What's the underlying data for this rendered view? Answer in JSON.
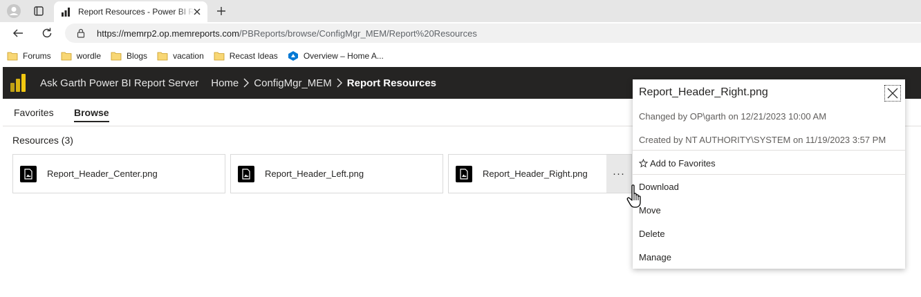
{
  "browser": {
    "tab": {
      "title": "Report Resources - Power BI Report Server"
    },
    "url": {
      "host": "https://memrp2.op.memreports.com",
      "path": "/PBReports/browse/ConfigMgr_MEM/Report%20Resources"
    },
    "bookmarks": [
      {
        "label": "Forums",
        "icon": "folder-icon"
      },
      {
        "label": "wordle",
        "icon": "folder-icon"
      },
      {
        "label": "Blogs",
        "icon": "folder-icon"
      },
      {
        "label": "vacation",
        "icon": "folder-icon"
      },
      {
        "label": "Recast Ideas",
        "icon": "folder-icon"
      },
      {
        "label": "Overview – Home A...",
        "icon": "azure-devops-icon"
      }
    ]
  },
  "app": {
    "title": "Ask Garth Power BI Report Server",
    "breadcrumb": [
      "Home",
      "ConfigMgr_MEM",
      "Report Resources"
    ]
  },
  "nav": {
    "tabs": [
      "Favorites",
      "Browse"
    ],
    "active": "Browse"
  },
  "resources": {
    "title": "Resources (3)",
    "items": [
      "Report_Header_Center.png",
      "Report_Header_Left.png",
      "Report_Header_Right.png"
    ],
    "more_label": "···"
  },
  "context_menu": {
    "title": "Report_Header_Right.png",
    "changed": "Changed by OP\\garth on 12/21/2023 10:00 AM",
    "created": "Created by NT AUTHORITY\\SYSTEM on 11/19/2023 3:57 PM",
    "items": [
      "Add to Favorites",
      "Download",
      "Move",
      "Delete",
      "Manage"
    ]
  },
  "colors": {
    "header_bg": "#252423",
    "powerbi_yellow": "#f2c811",
    "tab_strip": "#e6e6e6",
    "folder_yellow": "#f8d775"
  }
}
